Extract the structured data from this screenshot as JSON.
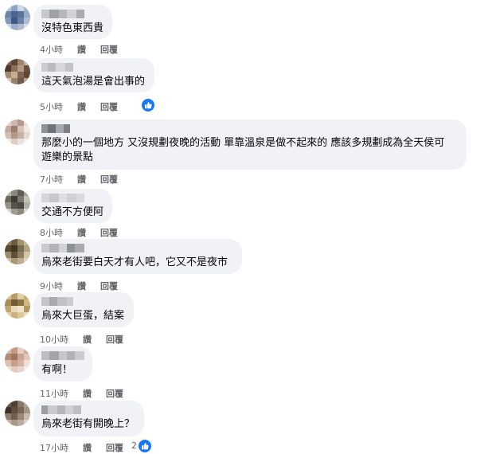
{
  "comments": [
    {
      "text": "沒特色東西貴",
      "time": "4小時",
      "like": "讚",
      "reply": "回覆",
      "reactions": ""
    },
    {
      "text": "這天氣泡湯是會出事的",
      "time": "5小時",
      "like": "讚",
      "reply": "回覆",
      "reactions": ""
    },
    {
      "text": "那麼小的一個地方 又沒規劃夜晚的活動 單靠溫泉是做不起來的 應該多規劃成為全天侯可\n遊樂的景點",
      "time": "7小時",
      "like": "讚",
      "reply": "回覆",
      "reactions": ""
    },
    {
      "text": "交通不方便阿",
      "time": "8小時",
      "like": "讚",
      "reply": "回覆",
      "reactions": ""
    },
    {
      "text": "烏來老街要白天才有人吧，它又不是夜市",
      "time": "9小時",
      "like": "讚",
      "reply": "回覆",
      "reactions": ""
    },
    {
      "text": "烏來大巨蛋，結案",
      "time": "10小時",
      "like": "讚",
      "reply": "回覆",
      "reactions": ""
    },
    {
      "text": "有啊！",
      "time": "11小時",
      "like": "讚",
      "reply": "回覆",
      "reactions": ""
    },
    {
      "text": "烏來老街有開晚上？",
      "time": "17小時",
      "like": "讚",
      "reply": "回覆",
      "reactions": "2"
    }
  ],
  "icons": {
    "reaction": "thumbs-up-icon"
  },
  "colors": {
    "bubble": "#f0f2f5",
    "meta": "#65676b",
    "like_blue": "#1877f2"
  }
}
